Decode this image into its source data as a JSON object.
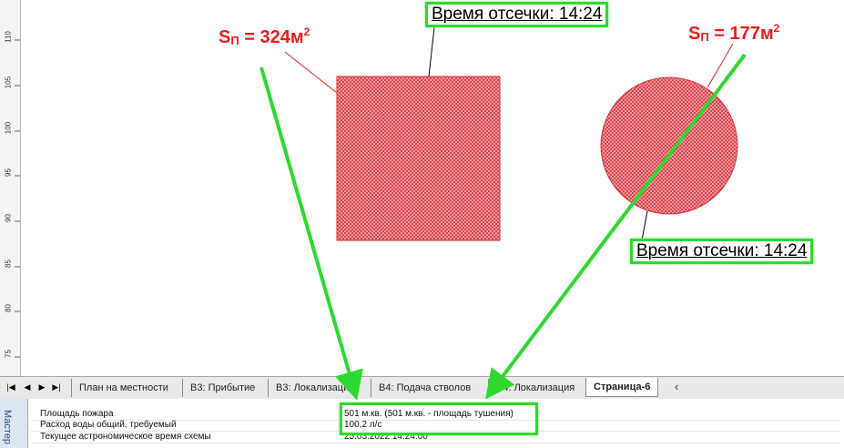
{
  "ruler": {
    "ticks": [
      "110",
      "105",
      "100",
      "95",
      "90",
      "85",
      "80",
      "75"
    ]
  },
  "drawing": {
    "square": {
      "label_s": "S",
      "label_sub": "П",
      "label_value": " = 324м",
      "label_sup": "2",
      "time_label": "Время отсечки: 14:24"
    },
    "circle": {
      "label_s": "S",
      "label_sub": "П",
      "label_value": " = 177м",
      "label_sup": "2",
      "time_label": "Время отсечки: 14:24"
    },
    "colors": {
      "fire_fill": "#e23b45",
      "annotation_green": "#2fd92f",
      "label_red": "#ee1c1c"
    }
  },
  "tabs": {
    "items": [
      {
        "label": "План на местности"
      },
      {
        "label": "В3: Прибытие"
      },
      {
        "label": "В3: Локализация"
      },
      {
        "label": "В4: Подача стволов"
      },
      {
        "label": "В4: Локализация"
      },
      {
        "label": "Страница-6"
      }
    ],
    "active": "Страница-6"
  },
  "panel": {
    "tab_label": "Мастер",
    "rows": [
      {
        "name": "Площадь пожара",
        "value": "501 м.кв. (501 м.кв. - площадь тушения)"
      },
      {
        "name": "Расход воды общий, требуемый",
        "value": "100,2 л/с"
      },
      {
        "name": "Текущее астрономическое время схемы",
        "value": "25.03.2022 14:24:00"
      }
    ]
  }
}
